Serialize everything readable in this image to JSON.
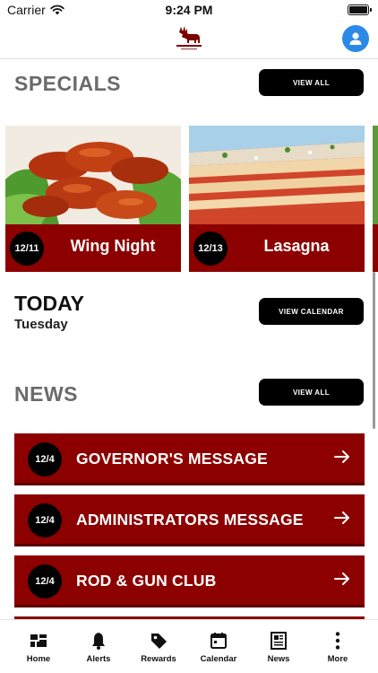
{
  "status_bar": {
    "carrier": "Carrier",
    "time": "9:24 PM"
  },
  "header": {
    "logo_icon": "moose-logo-icon",
    "profile_icon": "user-icon",
    "profile_color": "#2b8ae6"
  },
  "specials": {
    "title": "SPECIALS",
    "view_all_label": "VIEW ALL",
    "items": [
      {
        "date": "12/11",
        "name": "Wing Night",
        "image": "chicken-wings-image"
      },
      {
        "date": "12/13",
        "name": "Lasagna",
        "image": "lasagna-image"
      }
    ]
  },
  "today": {
    "title": "TODAY",
    "day": "Tuesday",
    "view_calendar_label": "VIEW CALENDAR"
  },
  "news": {
    "title": "NEWS",
    "view_all_label": "VIEW ALL",
    "items": [
      {
        "date": "12/4",
        "title": "GOVERNOR'S MESSAGE"
      },
      {
        "date": "12/4",
        "title": "ADMINISTRATORS MESSAGE"
      },
      {
        "date": "12/4",
        "title": "ROD & GUN CLUB"
      }
    ]
  },
  "tabs": [
    {
      "label": "Home",
      "icon": "grid-icon"
    },
    {
      "label": "Alerts",
      "icon": "bell-icon"
    },
    {
      "label": "Rewards",
      "icon": "tag-icon"
    },
    {
      "label": "Calendar",
      "icon": "calendar-icon"
    },
    {
      "label": "News",
      "icon": "newspaper-icon"
    },
    {
      "label": "More",
      "icon": "more-icon"
    }
  ],
  "colors": {
    "accent": "#8c0000",
    "button": "#000000",
    "section_title": "#6b6b6b"
  }
}
